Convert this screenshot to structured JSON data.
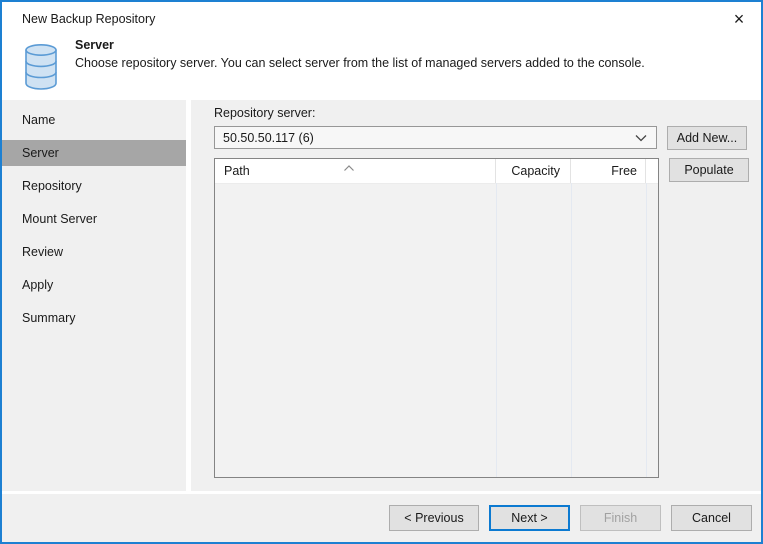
{
  "window": {
    "title": "New Backup Repository",
    "close_icon": "×"
  },
  "header": {
    "icon": "database-icon",
    "title": "Server",
    "description": "Choose repository server. You can select server from the list of managed servers added to the console."
  },
  "sidebar": {
    "items": [
      {
        "label": "Name",
        "selected": false
      },
      {
        "label": "Server",
        "selected": true
      },
      {
        "label": "Repository",
        "selected": false
      },
      {
        "label": "Mount Server",
        "selected": false
      },
      {
        "label": "Review",
        "selected": false
      },
      {
        "label": "Apply",
        "selected": false
      },
      {
        "label": "Summary",
        "selected": false
      }
    ]
  },
  "main": {
    "repository_server_label": "Repository server:",
    "server_select": {
      "value": "50.50.50.117 (6)",
      "expanded": false
    },
    "add_new_button": "Add New...",
    "populate_button": "Populate",
    "table": {
      "columns": [
        {
          "label": "Path",
          "align": "left",
          "sort": "ascending"
        },
        {
          "label": "Capacity",
          "align": "right",
          "sort": null
        },
        {
          "label": "Free",
          "align": "right",
          "sort": null
        }
      ],
      "rows": []
    }
  },
  "footer": {
    "previous_button": "< Previous",
    "next_button": "Next >",
    "finish_button": {
      "label": "Finish",
      "enabled": false
    },
    "cancel_button": "Cancel"
  },
  "colors": {
    "accent_border": "#1d80d2",
    "focus_border": "#0c7ad1",
    "selected_step_bg": "#a6a6a6",
    "body_bg": "#f0f0f0",
    "button_bg": "#e1e1e1",
    "button_border": "#adadad",
    "icon_fill": "#cfe2f3",
    "icon_stroke": "#5b9bd5"
  }
}
